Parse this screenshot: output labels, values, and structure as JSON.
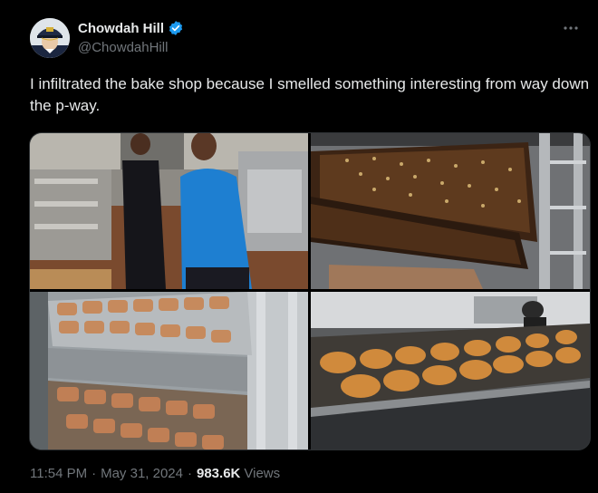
{
  "author": {
    "display_name": "Chowdah Hill",
    "handle": "@ChowdahHill",
    "verified": true,
    "avatar_icon": "avatar-captain-hat"
  },
  "tweet": {
    "text": "I infiltrated the bake shop because I smelled something interesting from way down the p-way."
  },
  "media": {
    "count": 4,
    "photos": [
      "bakery-workers-photo",
      "sheet-pan-bars-photo",
      "pastry-rack-photo",
      "muffin-trays-photo"
    ]
  },
  "meta": {
    "time": "11:54 PM",
    "separator": "·",
    "date": "May 31, 2024",
    "views_count": "983.6K",
    "views_label": "Views"
  },
  "colors": {
    "background": "#000000",
    "text": "#e7e9ea",
    "secondary": "#71767b",
    "verified": "#1d9bf0"
  }
}
